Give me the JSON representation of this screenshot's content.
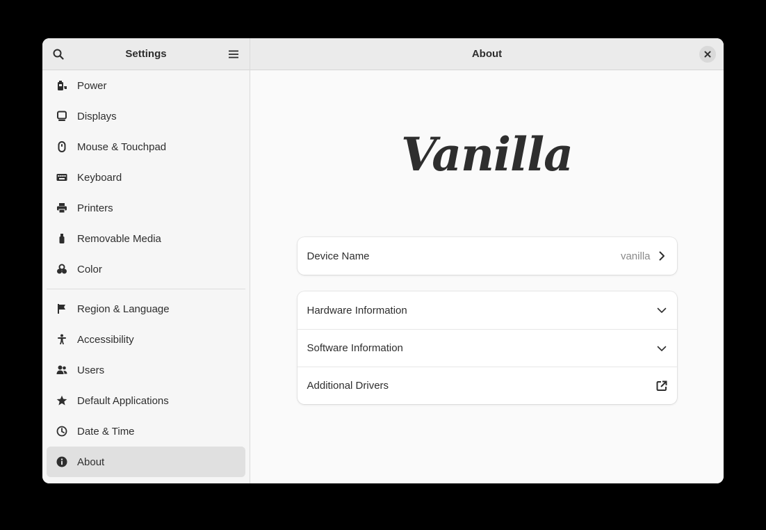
{
  "sidebar": {
    "title": "Settings",
    "search_icon": "search-icon",
    "menu_icon": "hamburger-menu-icon",
    "group1": [
      {
        "label": "Power",
        "icon": "power-icon"
      },
      {
        "label": "Displays",
        "icon": "display-icon"
      },
      {
        "label": "Mouse & Touchpad",
        "icon": "mouse-icon"
      },
      {
        "label": "Keyboard",
        "icon": "keyboard-icon"
      },
      {
        "label": "Printers",
        "icon": "printer-icon"
      },
      {
        "label": "Removable Media",
        "icon": "usb-icon"
      },
      {
        "label": "Color",
        "icon": "color-icon"
      }
    ],
    "group2": [
      {
        "label": "Region & Language",
        "icon": "flag-icon"
      },
      {
        "label": "Accessibility",
        "icon": "accessibility-icon"
      },
      {
        "label": "Users",
        "icon": "users-icon"
      },
      {
        "label": "Default Applications",
        "icon": "star-icon"
      },
      {
        "label": "Date & Time",
        "icon": "clock-icon"
      },
      {
        "label": "About",
        "icon": "info-icon",
        "selected": true
      }
    ]
  },
  "content": {
    "title": "About",
    "logo_text": "Vanilla",
    "device": {
      "label": "Device Name",
      "value": "vanilla"
    },
    "info_rows": [
      {
        "label": "Hardware Information",
        "icon": "chevron-down-icon"
      },
      {
        "label": "Software Information",
        "icon": "chevron-down-icon"
      },
      {
        "label": "Additional Drivers",
        "icon": "external-link-icon"
      }
    ]
  },
  "colors": {
    "window_bg": "#fafafa",
    "sidebar_bg": "#f6f6f6",
    "header_bg": "#ebebeb",
    "selected_bg": "#e0e0e0",
    "text": "#2e2e2e",
    "muted_text": "#8a8a8a"
  }
}
